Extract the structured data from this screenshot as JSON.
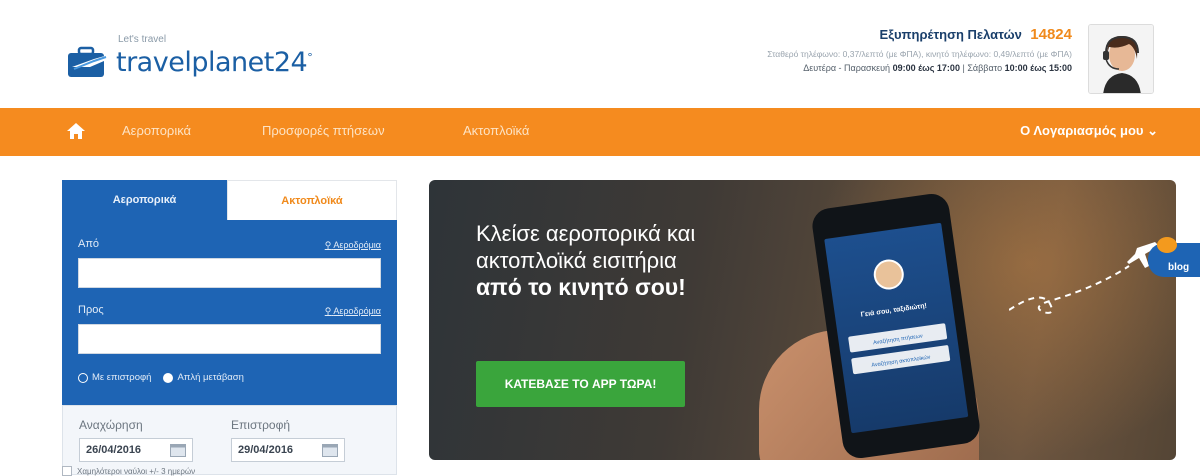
{
  "logo": {
    "tagline": "Let's travel",
    "name": "travelplanet24",
    "sup": "°"
  },
  "support": {
    "title": "Εξυπηρέτηση Πελατών",
    "phone": "14824",
    "line1": "Σταθερό τηλέφωνο: 0,37/λεπτό (με ΦΠΑ), κινητό τηλέφωνο: 0,49/λεπτό (με ΦΠΑ)",
    "weekdays_label": "Δευτέρα - Παρασκευή",
    "weekdays_hours": "09:00 έως 17:00",
    "separator": "|",
    "saturday_label": "Σάββατο",
    "saturday_hours": "10:00 έως 15:00"
  },
  "nav": {
    "items": [
      "Αεροπορικά",
      "Προσφορές πτήσεων",
      "Ακτοπλοϊκά"
    ],
    "account": "Ο Λογαριασμός μου"
  },
  "search": {
    "tabs": [
      "Αεροπορικά",
      "Ακτοπλοϊκά"
    ],
    "from_label": "Από",
    "to_label": "Προς",
    "airports_link": "Αεροδρόμια",
    "from_value": "",
    "to_value": "",
    "trip_options": [
      "Με επιστροφή",
      "Απλή μετάβαση"
    ],
    "trip_selected": "Απλή μετάβαση",
    "departure_label": "Αναχώρηση",
    "return_label": "Επιστροφή",
    "departure_value": "26/04/2016",
    "return_value": "29/04/2016",
    "flex_label": "Χαμηλότεροι ναύλοι +/- 3 ημερών"
  },
  "banner": {
    "line1": "Κλείσε αεροπορικά και",
    "line2": "ακτοπλοϊκά εισιτήρια",
    "line3": "από το κινητό σου!",
    "cta": "ΚΑΤΕΒΑΣΕ ΤΟ APP ΤΩΡΑ!",
    "phone_greeting": "Γειά σου, ταξιδιώτη!",
    "phone_btn1": "Αναζήτηση πτήσεων",
    "phone_btn2": "Αναζήτηση ακτοπλοϊκών"
  },
  "blog": {
    "label": "blog"
  },
  "colors": {
    "nav_orange": "#f58b1f",
    "brand_blue": "#1e64b4",
    "cta_green": "#3aa53c",
    "phone_orange": "#f08a1c"
  }
}
